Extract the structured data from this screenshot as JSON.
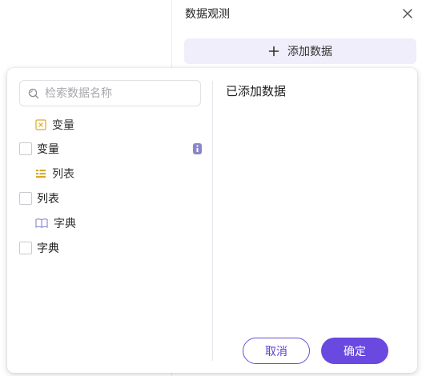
{
  "panel": {
    "title": "数据观测",
    "add_button_label": "添加数据"
  },
  "picker": {
    "search_placeholder": "检索数据名称",
    "groups": [
      {
        "label": "变量",
        "icon": "variable-icon",
        "item_label": "变量"
      },
      {
        "label": "列表",
        "icon": "list-icon",
        "item_label": "列表"
      },
      {
        "label": "字典",
        "icon": "dictionary-icon",
        "item_label": "字典"
      }
    ],
    "added_title": "已添加数据",
    "cancel_label": "取消",
    "confirm_label": "确定"
  },
  "colors": {
    "accent": "#6a49e0",
    "accent_light": "#f1eefb",
    "group_icon": "#d9a92a",
    "dict_icon": "#8f8fd6"
  }
}
